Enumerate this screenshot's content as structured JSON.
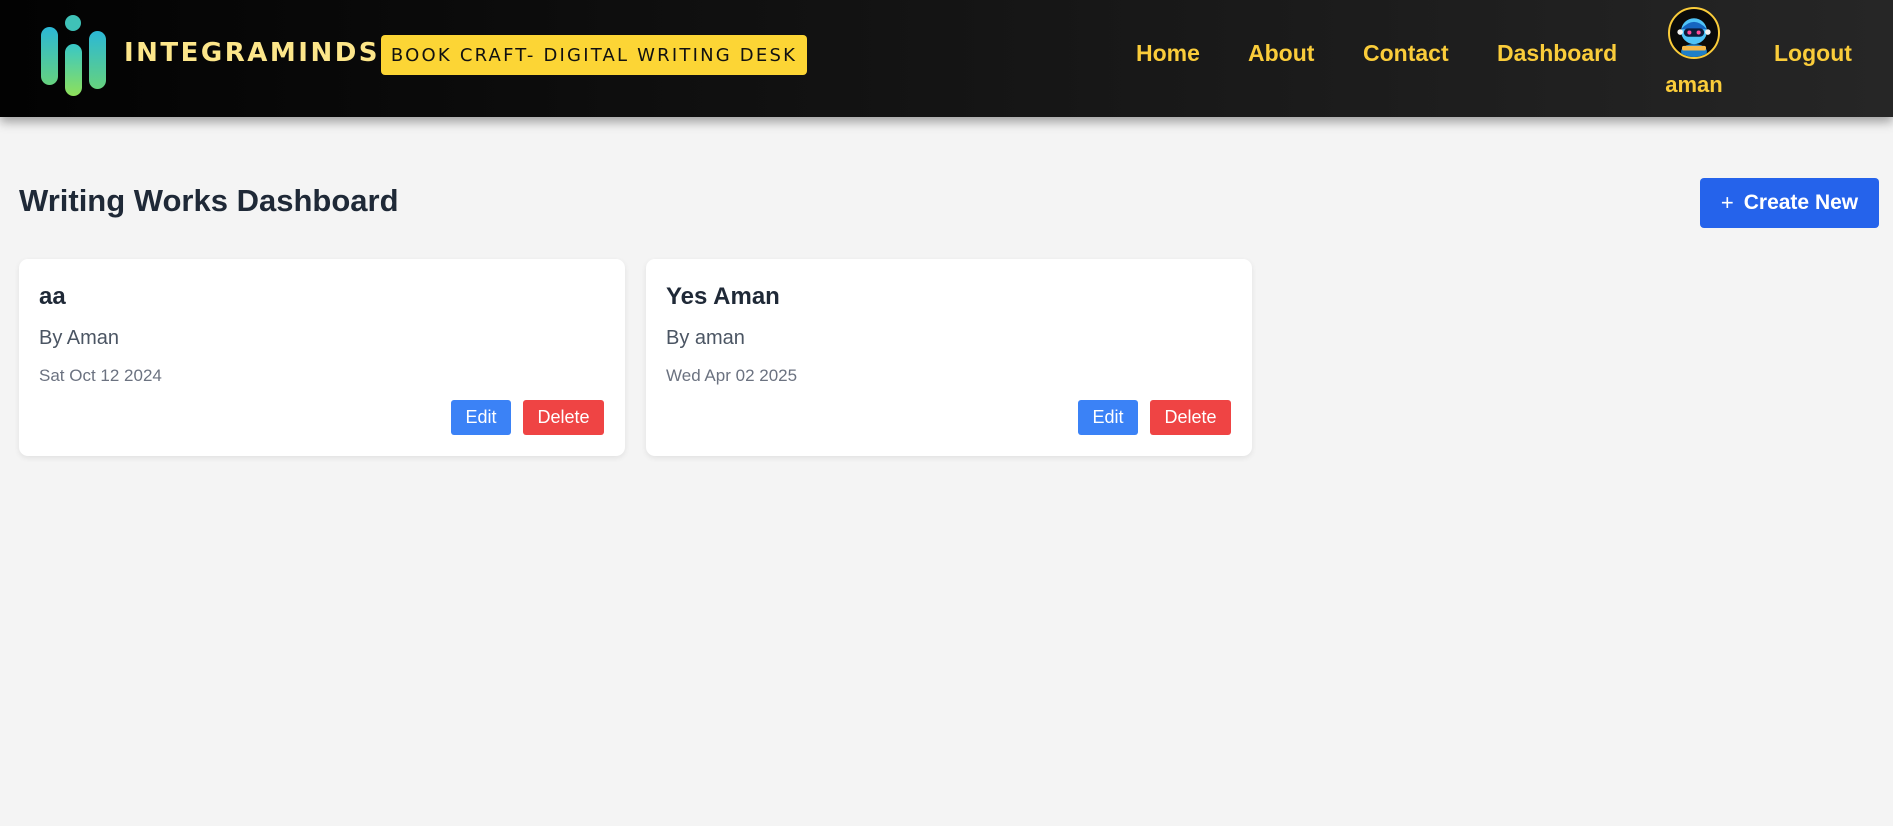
{
  "header": {
    "brand": "INTEGRAMINDS",
    "tagline": "BOOK CRAFT- DIGITAL WRITING DESK",
    "nav": [
      "Home",
      "About",
      "Contact",
      "Dashboard"
    ],
    "user": "aman",
    "logout": "Logout",
    "icons": {
      "logo": "integraminds-logo-icon",
      "avatar": "robot-avatar-icon"
    }
  },
  "main": {
    "title": "Writing Works Dashboard",
    "create_icon": "+",
    "create_label": "Create New",
    "works": [
      {
        "title": "aa",
        "author": "By Aman",
        "date": "Sat Oct 12 2024",
        "edit": "Edit",
        "delete": "Delete"
      },
      {
        "title": "Yes Aman",
        "author": "By aman",
        "date": "Wed Apr 02 2025",
        "edit": "Edit",
        "delete": "Delete"
      }
    ]
  },
  "colors": {
    "header_bg": "#0a0a0a",
    "accent_yellow": "#facc3a",
    "tagline_bg": "#fcd535",
    "primary_blue": "#2563eb",
    "edit_blue": "#3b82f6",
    "delete_red": "#ef4444",
    "page_bg": "#f4f4f4"
  }
}
